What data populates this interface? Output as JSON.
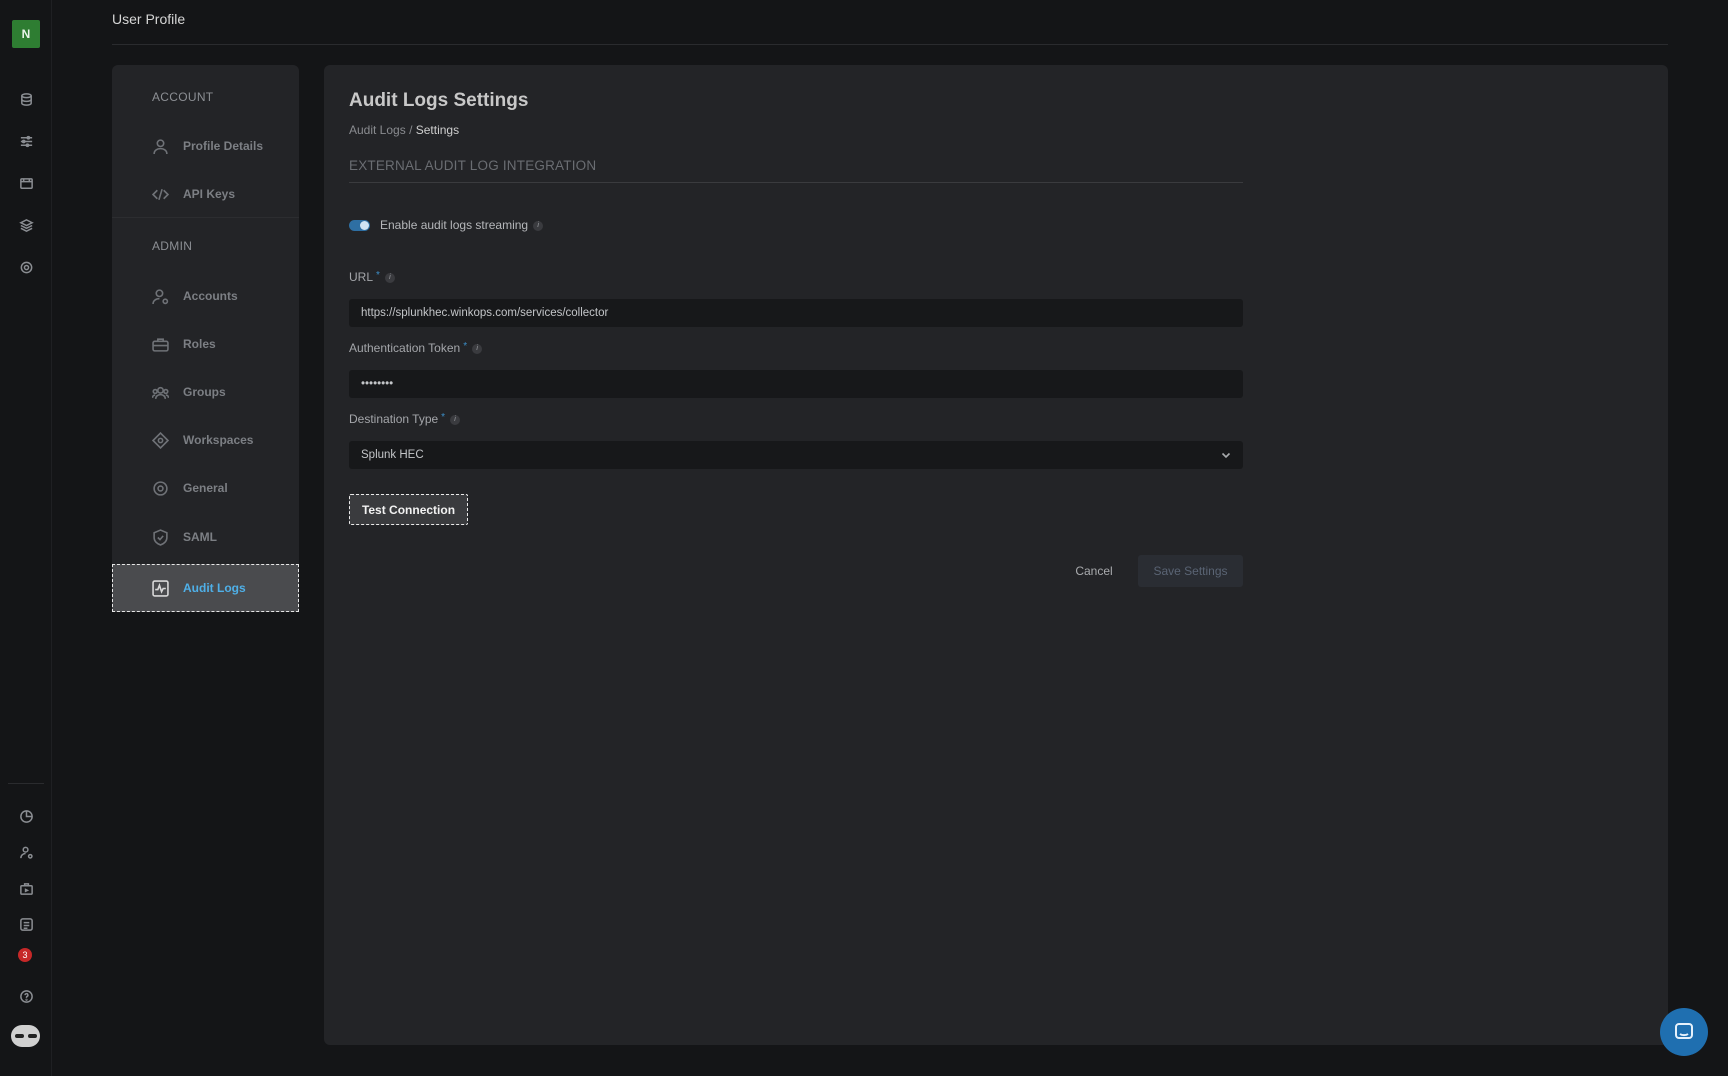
{
  "app": {
    "avatar_initial": "N",
    "page_title": "User Profile",
    "notification_count": "3",
    "accent_color": "#4fb0e8"
  },
  "rail": {
    "top_icons": [
      "database-icon",
      "sliders-icon",
      "calendar-icon",
      "layers-icon",
      "settings-icon"
    ],
    "bottom_icons": [
      "pie-chart-icon",
      "user-settings-icon",
      "briefcase-icon",
      "list-icon",
      "bell-icon",
      "help-icon",
      "bot-icon"
    ]
  },
  "settings_nav": {
    "account_heading": "ACCOUNT",
    "admin_heading": "ADMIN",
    "items": [
      {
        "label": "Profile Details",
        "icon": "user-icon"
      },
      {
        "label": "API Keys",
        "icon": "code-icon"
      },
      {
        "label": "Accounts",
        "icon": "user-gear-icon"
      },
      {
        "label": "Roles",
        "icon": "briefcase-icon"
      },
      {
        "label": "Groups",
        "icon": "group-icon"
      },
      {
        "label": "Workspaces",
        "icon": "diamond-icon"
      },
      {
        "label": "General",
        "icon": "gear-icon"
      },
      {
        "label": "SAML",
        "icon": "shield-icon"
      },
      {
        "label": "Audit Logs",
        "icon": "activity-icon"
      }
    ],
    "active": "Audit Logs"
  },
  "main": {
    "title": "Audit Logs Settings",
    "breadcrumb_parent": "Audit Logs",
    "breadcrumb_sep": "/",
    "breadcrumb_current": "Settings",
    "section_title": "EXTERNAL AUDIT LOG INTEGRATION",
    "toggle_label": "Enable audit logs streaming",
    "toggle_on": true,
    "url_label": "URL",
    "url_value": "https://splunkhec.winkops.com/services/collector",
    "token_label": "Authentication Token",
    "token_value": "••••••••",
    "dest_label": "Destination Type",
    "dest_value": "Splunk HEC",
    "required_mark": "*",
    "info_mark": "i",
    "test_button": "Test Connection",
    "cancel_button": "Cancel",
    "save_button": "Save Settings"
  }
}
